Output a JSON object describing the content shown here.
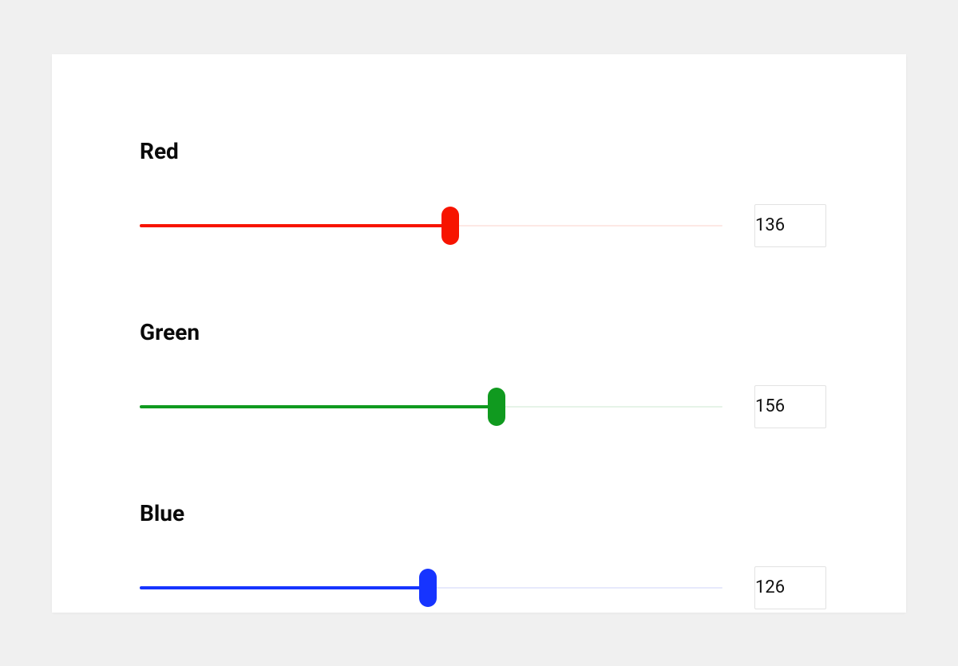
{
  "sliders": [
    {
      "id": "red",
      "label": "Red",
      "value": 136,
      "min": 0,
      "max": 255,
      "color": "#f71400",
      "track_bg": "#fde8e5"
    },
    {
      "id": "green",
      "label": "Green",
      "value": 156,
      "min": 0,
      "max": 255,
      "color": "#109a1f",
      "track_bg": "#e6f3e8"
    },
    {
      "id": "blue",
      "label": "Blue",
      "value": 126,
      "min": 0,
      "max": 255,
      "color": "#1634ff",
      "track_bg": "#e7e9fc"
    }
  ]
}
